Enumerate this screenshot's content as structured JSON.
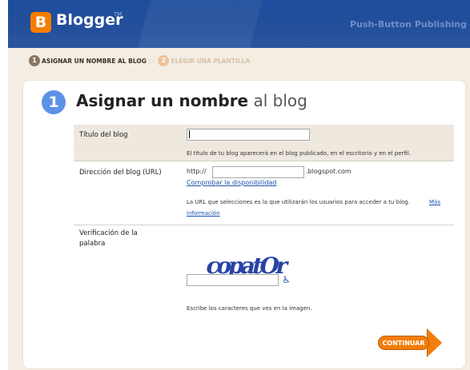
{
  "header": {
    "logo_letter": "B",
    "logo_text": "Blogger",
    "logo_tm": "TM",
    "tagline": "Push-Button Publishing"
  },
  "steps": [
    {
      "num": "1",
      "label": "ASIGNAR UN NOMBRE AL BLOG"
    },
    {
      "num": "2",
      "label": "ELEGIR UNA PLANTILLA"
    }
  ],
  "main": {
    "step_number": "1",
    "title_bold": "Asignar un nombre",
    "title_light": "al blog"
  },
  "form": {
    "title_label": "Título del blog",
    "title_value": "",
    "title_help": "El título de tu blog aparecerá en el blog publicado, en el escritorio y en el perfil.",
    "url_label": "Dirección del blog (URL)",
    "url_prefix": "http://",
    "url_value": "",
    "url_suffix": ".blogspot.com",
    "check_link": "Comprobar la disponibilidad",
    "url_help": "La URL que selecciones es la que utilizarán los usuarios para acceder a tu blog.",
    "more_info_link": "Más información",
    "verify_label_1": "Verificación de la",
    "verify_label_2": "palabra",
    "captcha_text": "copatOr",
    "captcha_value": "",
    "captcha_help": "Escribe los caracteres que ves en la imagen.",
    "continue_label": "CONTINUAR"
  },
  "colors": {
    "header_blue": "#244f9b",
    "accent_orange": "#f37e0b",
    "link_blue": "#1a54b0",
    "step_blue": "#5c92e6"
  }
}
